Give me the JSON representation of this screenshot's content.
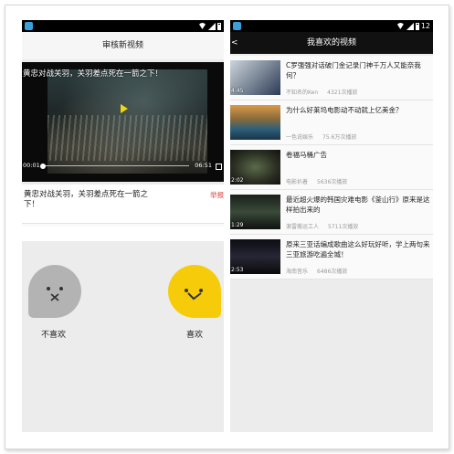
{
  "left": {
    "title": "审核新视频",
    "video": {
      "caption": "黄忠对战关羽，关羽差点死在一箭之下！",
      "time_current": "00:01",
      "time_total": "06:51",
      "progress": 0.0
    },
    "description": "黄忠对战关羽，关羽差点死在一箭之下！",
    "report_label": "举报",
    "dislike_label": "不喜欢",
    "like_label": "喜欢",
    "colors": {
      "dislike": "#b3b3b3",
      "like": "#f6cc0a"
    }
  },
  "right": {
    "title": "我喜欢的视频",
    "status_time": "12",
    "items": [
      {
        "title": "C罗强强对话破门金记录门神千万人又能奈我何？",
        "author": "不知名的Ken",
        "plays": "4321次播放",
        "duration": "4:45"
      },
      {
        "title": "为什么好莱坞电影动不动就上亿美金？",
        "author": "一色说娱乐",
        "plays": "75.6万次播放",
        "duration": ""
      },
      {
        "title": "卷福马桶广告",
        "author": "电影扒着",
        "plays": "5636次播放",
        "duration": "2:02"
      },
      {
        "title": "最近超火爆的韩国灾难电影《釜山行》原来是这样拍出来的",
        "author": "滚雷搬运工人",
        "plays": "5711次播放",
        "duration": "1:29"
      },
      {
        "title": "原来三亚话编成歌曲这么好玩好听，学上两句来三亚旅游吃遍全城！",
        "author": "海南音乐",
        "plays": "6486次播放",
        "duration": "2:53"
      }
    ]
  }
}
